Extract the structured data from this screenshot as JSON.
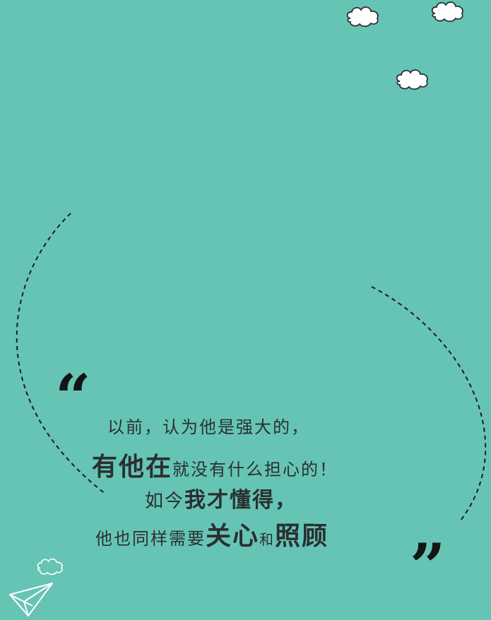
{
  "colors": {
    "background": "#66c4b5",
    "text": "#2a2f31",
    "quote_mark": "#141414",
    "cloud_fill": "#ffffff",
    "cloud_stroke": "#2a2f31",
    "dash": "#1d1d1d"
  },
  "quote": {
    "open_mark": "“",
    "close_mark": "”",
    "line1": "以前，认为他是强大的，",
    "line2": {
      "a": "有他在",
      "b": "就没有什么担心的！"
    },
    "line3": {
      "a": "如今",
      "b": "我才懂得，"
    },
    "line4": {
      "a": "他也同样需要",
      "b": "关心",
      "c": "和",
      "d": "照顾"
    }
  },
  "icons": [
    "cloud-icon",
    "cloud-icon",
    "cloud-icon",
    "cloud-icon",
    "paper-plane-icon"
  ]
}
